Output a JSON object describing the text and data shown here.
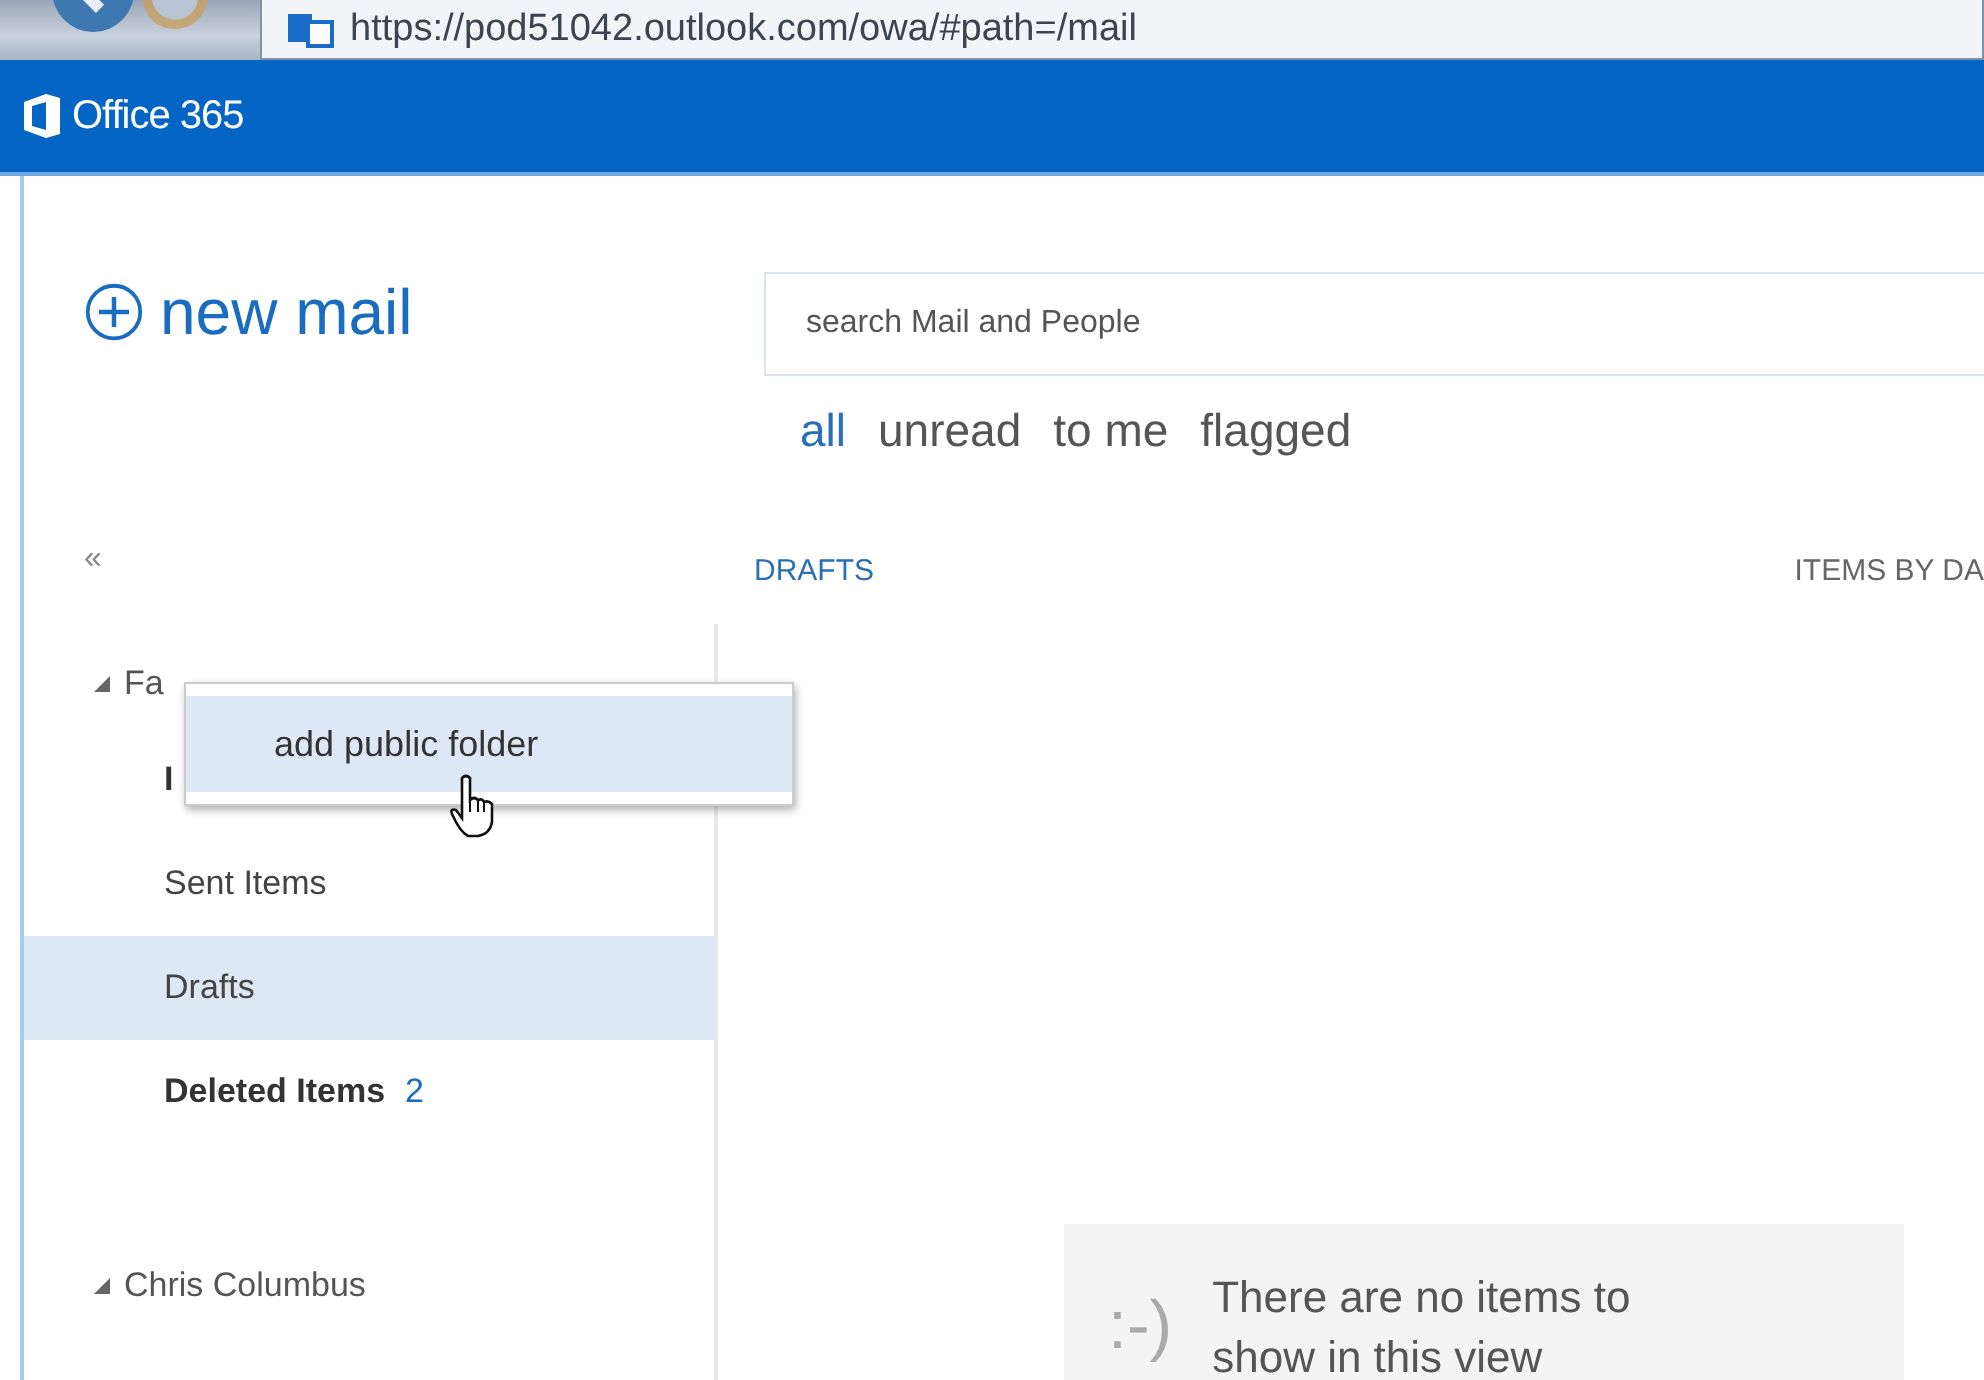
{
  "browser": {
    "address": "https://pod51042.outlook.com/owa/#path=/mail"
  },
  "suite_bar": {
    "title": "Office 365"
  },
  "new_mail": {
    "label": "new mail"
  },
  "collapse": {
    "label": "«"
  },
  "search": {
    "placeholder": "search Mail and People"
  },
  "filters": [
    {
      "label": "all",
      "selected": true
    },
    {
      "label": "unread",
      "selected": false
    },
    {
      "label": "to me",
      "selected": false
    },
    {
      "label": "flagged",
      "selected": false
    }
  ],
  "list_header": {
    "folder": "DRAFTS",
    "sort": "ITEMS BY DA"
  },
  "folders": [
    {
      "kind": "group",
      "label": "Fa",
      "expanded": true
    },
    {
      "kind": "folder",
      "label": "I",
      "unread": true,
      "selected": false
    },
    {
      "kind": "folder",
      "label": "Sent Items",
      "unread": false,
      "selected": false
    },
    {
      "kind": "folder",
      "label": "Drafts",
      "unread": false,
      "selected": true
    },
    {
      "kind": "folder",
      "label": "Deleted Items",
      "count": "2",
      "unread": true,
      "selected": false
    },
    {
      "kind": "spacer"
    },
    {
      "kind": "group",
      "label": "Chris Columbus",
      "expanded": true
    }
  ],
  "context_menu": {
    "items": [
      {
        "label": "add public folder",
        "selected": true
      }
    ]
  },
  "empty_state": {
    "emoticon": ":-)",
    "message": "There are no items to show in this view"
  }
}
